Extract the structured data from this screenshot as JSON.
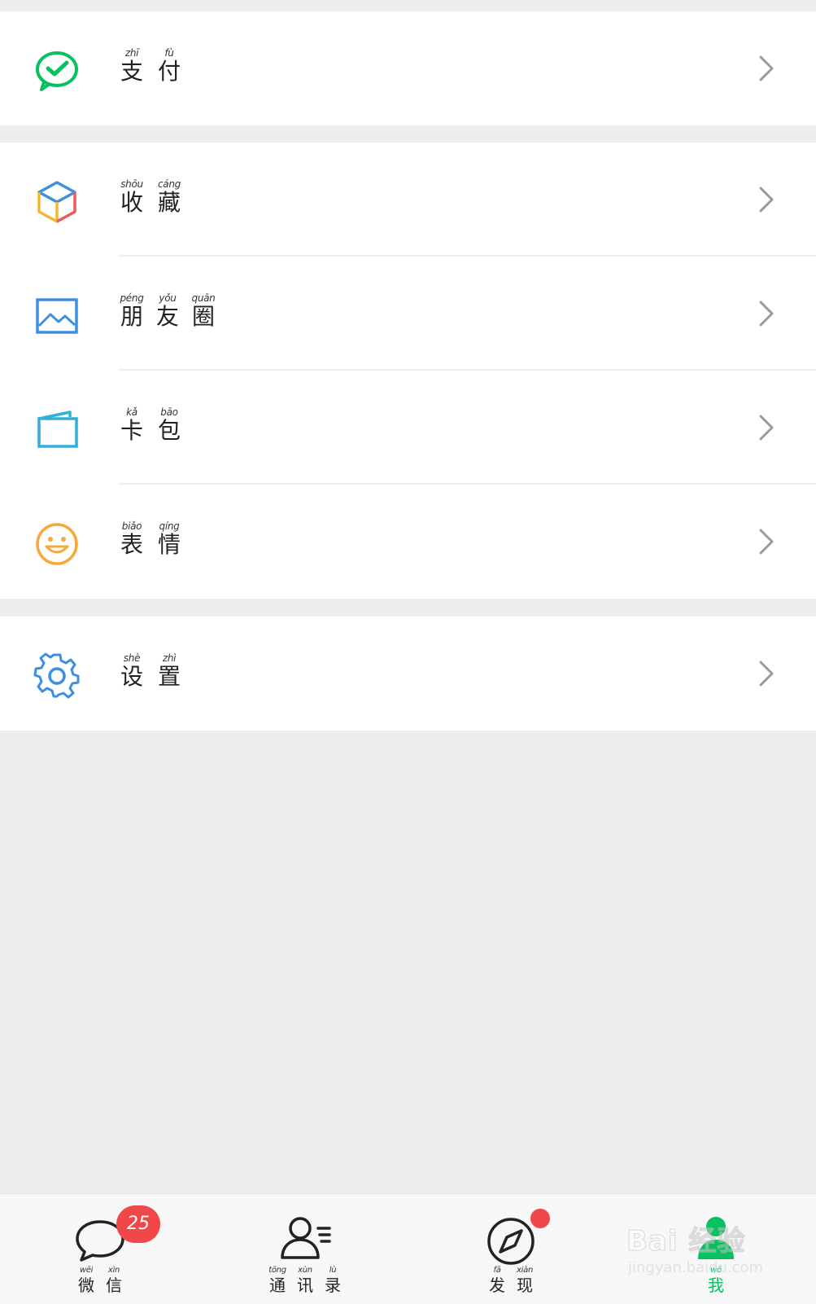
{
  "menu_groups": [
    {
      "items": [
        {
          "id": "pay",
          "icon": "wechat-pay-icon",
          "chars": [
            {
              "py": "zhī",
              "hz": "支"
            },
            {
              "py": "fù",
              "hz": "付"
            }
          ]
        }
      ]
    },
    {
      "items": [
        {
          "id": "favorites",
          "icon": "cube-icon",
          "chars": [
            {
              "py": "shōu",
              "hz": "收"
            },
            {
              "py": "cáng",
              "hz": "藏"
            }
          ]
        },
        {
          "id": "moments",
          "icon": "image-icon",
          "chars": [
            {
              "py": "péng",
              "hz": "朋"
            },
            {
              "py": "yǒu",
              "hz": "友"
            },
            {
              "py": "quān",
              "hz": "圈"
            }
          ]
        },
        {
          "id": "cards",
          "icon": "card-wallet-icon",
          "chars": [
            {
              "py": "kǎ",
              "hz": "卡"
            },
            {
              "py": "bāo",
              "hz": "包"
            }
          ]
        },
        {
          "id": "stickers",
          "icon": "smiley-icon",
          "chars": [
            {
              "py": "biǎo",
              "hz": "表"
            },
            {
              "py": "qíng",
              "hz": "情"
            }
          ]
        }
      ]
    },
    {
      "items": [
        {
          "id": "settings",
          "icon": "gear-icon",
          "chars": [
            {
              "py": "shè",
              "hz": "设"
            },
            {
              "py": "zhì",
              "hz": "置"
            }
          ]
        }
      ]
    }
  ],
  "tabbar": {
    "tabs": [
      {
        "id": "chats",
        "icon": "chat-bubble-icon",
        "badge": "25",
        "chars": [
          {
            "py": "wēi",
            "hz": "微"
          },
          {
            "py": "xìn",
            "hz": "信"
          }
        ]
      },
      {
        "id": "contacts",
        "icon": "contacts-icon",
        "chars": [
          {
            "py": "tōng",
            "hz": "通"
          },
          {
            "py": "xùn",
            "hz": "讯"
          },
          {
            "py": "lù",
            "hz": "录"
          }
        ]
      },
      {
        "id": "discover",
        "icon": "compass-icon",
        "dot": true,
        "chars": [
          {
            "py": "fā",
            "hz": "发"
          },
          {
            "py": "xiàn",
            "hz": "现"
          }
        ]
      },
      {
        "id": "me",
        "icon": "person-icon",
        "active": true,
        "chars": [
          {
            "py": "wǒ",
            "hz": "我"
          }
        ]
      }
    ]
  },
  "watermark": {
    "main": "Bai 经验",
    "sub": "jingyan.baidu.com"
  },
  "colors": {
    "accent_green": "#07c160",
    "badge_red": "#f04848",
    "background": "#ededed"
  }
}
